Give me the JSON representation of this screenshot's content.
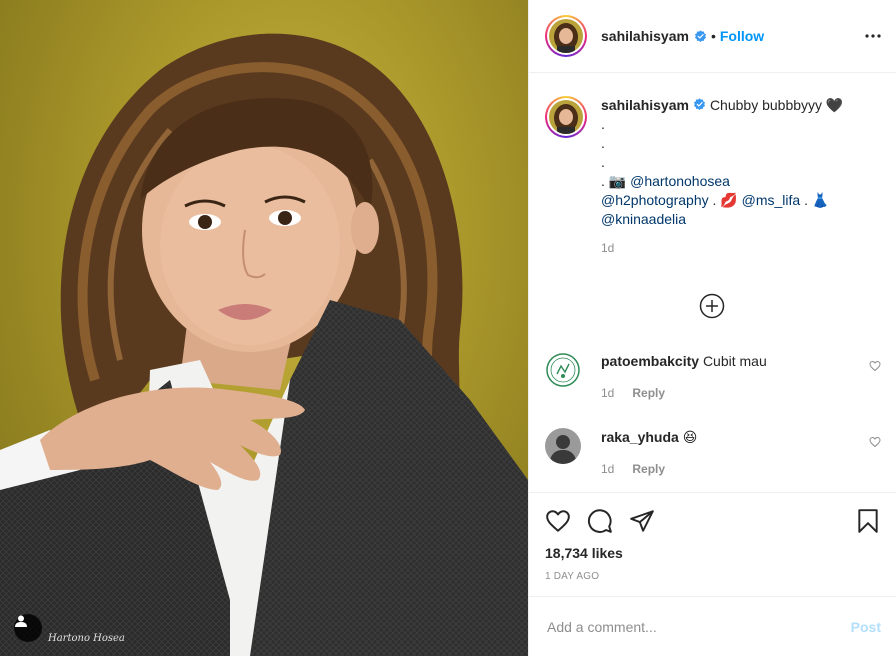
{
  "post": {
    "watermark": "Hartono Hosea"
  },
  "header": {
    "username": "sahilahisyam",
    "separator": "•",
    "follow_label": "Follow"
  },
  "caption": {
    "username": "sahilahisyam",
    "line1": "Chubby bubbbyyy 🖤",
    "dots": [
      ".",
      ".",
      "."
    ],
    "credit_prefix": ". 📷 ",
    "mention1": "@hartonohosea",
    "mention2": "@h2photography",
    "sep1": " . 💋 ",
    "mention3": "@ms_lifa",
    "sep2": " . 👗",
    "mention4": "@kninaadelia",
    "time": "1d"
  },
  "comments": [
    {
      "username": "patoembakcity",
      "text": "Cubit mau",
      "time": "1d",
      "reply_label": "Reply"
    },
    {
      "username": "raka_yhuda",
      "text": "😆",
      "time": "1d",
      "reply_label": "Reply"
    }
  ],
  "actions": {
    "likes": "18,734 likes",
    "posted": "1 DAY AGO"
  },
  "add_comment": {
    "placeholder": "Add a comment...",
    "post_label": "Post"
  },
  "colors": {
    "accent": "#0095f6",
    "post_disabled": "#b2dffc",
    "mention": "#00376b",
    "muted": "#8e8e8e"
  }
}
